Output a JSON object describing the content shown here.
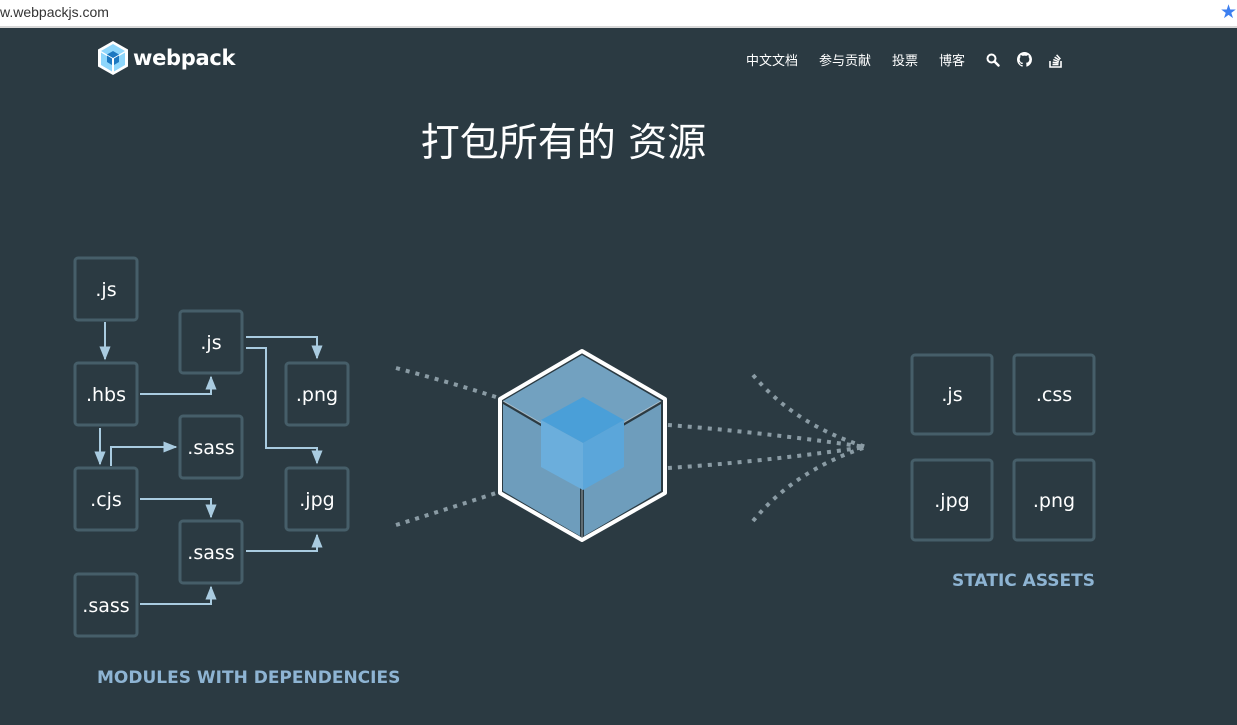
{
  "browser": {
    "url": "w.webpackjs.com",
    "bookmark_icon": "star-icon"
  },
  "header": {
    "logo_text": "webpack",
    "nav": [
      {
        "label": "中文文档"
      },
      {
        "label": "参与贡献"
      },
      {
        "label": "投票"
      },
      {
        "label": "博客"
      }
    ],
    "icons": [
      "search-icon",
      "github-icon",
      "stackoverflow-icon"
    ]
  },
  "hero": {
    "title": "打包所有的 资源",
    "modules": [
      ".js",
      ".js",
      ".png",
      ".hbs",
      ".sass",
      ".cjs",
      ".jpg",
      ".sass",
      ".sass"
    ],
    "modules_caption": "MODULES WITH DEPENDENCIES",
    "assets": [
      ".js",
      ".css",
      ".jpg",
      ".png"
    ],
    "assets_caption": "STATIC ASSETS"
  },
  "colors": {
    "background": "#2b3a42",
    "box_border": "#465e69",
    "arrow": "#a9cbe0",
    "caption": "#8eb4d3",
    "cube_light": "#8ed6fb",
    "cube_dark": "#1c78c0"
  }
}
